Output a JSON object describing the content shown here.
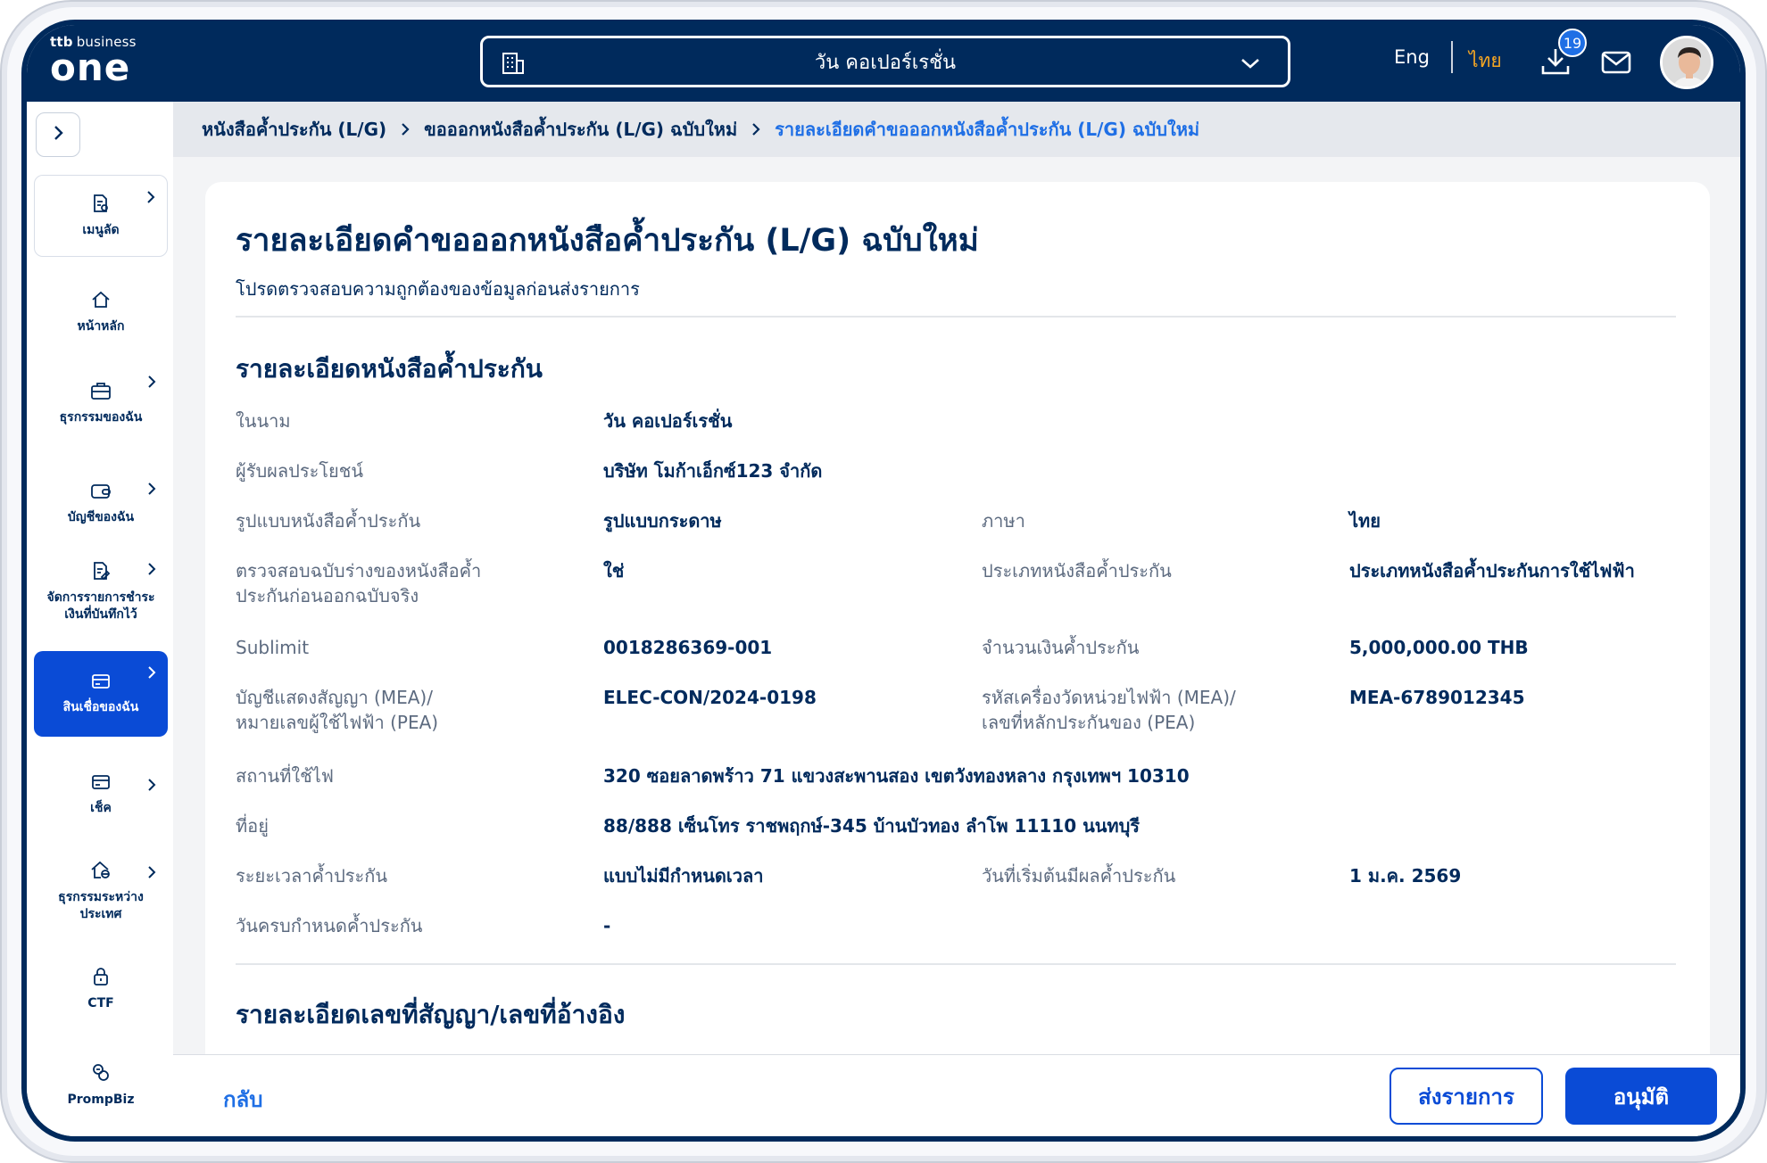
{
  "header": {
    "logo_brand": "ttb",
    "logo_small": "business",
    "logo_big": "one",
    "company": "วัน คอเปอร์เรชั่น",
    "lang_eng": "Eng",
    "lang_thai": "ไทย",
    "download_count": "19"
  },
  "sidebar": {
    "items": [
      {
        "label": "เมนูลัด"
      },
      {
        "label": "หน้าหลัก"
      },
      {
        "label": "ธุรกรรมของฉัน"
      },
      {
        "label": "บัญชีของฉัน"
      },
      {
        "label": "จัดการรายการชำระเงินที่บันทึกไว้"
      },
      {
        "label": "สินเชื่อของฉัน"
      },
      {
        "label": "เช็ค"
      },
      {
        "label": "ธุรกรรมระหว่างประเทศ"
      },
      {
        "label": "CTF"
      },
      {
        "label": "PrompBiz"
      }
    ]
  },
  "breadcrumb": {
    "items": [
      "หนังสือค้ำประกัน (L/G)",
      "ขอออกหนังสือค้ำประกัน (L/G) ฉบับใหม่",
      "รายละเอียดคำขอออกหนังสือค้ำประกัน (L/G) ฉบับใหม่"
    ]
  },
  "page": {
    "title": "รายละเอียดคำขอออกหนังสือค้ำประกัน (L/G) ฉบับใหม่",
    "subtitle": "โปรดตรวจสอบความถูกต้องของข้อมูลก่อนส่งรายการ",
    "section1_title": "รายละเอียดหนังสือค้ำประกัน",
    "section2_title": "รายละเอียดเลขที่สัญญา/เลขที่อ้างอิง"
  },
  "fields": {
    "name_label": "ในนาม",
    "name_value": "วัน คอเปอร์เรชั่น",
    "beneficiary_label": "ผู้รับผลประโยชน์",
    "beneficiary_value": "บริษัท โมก้าเอ็กซ์123 จำกัด",
    "format_label": "รูปแบบหนังสือค้ำประกัน",
    "format_value": "รูปแบบกระดาษ",
    "language_label": "ภาษา",
    "language_value": "ไทย",
    "draft_label_1": "ตรวจสอบฉบับร่างของหนังสือค้ำ",
    "draft_label_2": "ประกันก่อนออกฉบับจริง",
    "draft_value": "ใช่",
    "type_label": "ประเภทหนังสือค้ำประกัน",
    "type_value": "ประเภทหนังสือค้ำประกันการใช้ไฟฟ้า",
    "sublimit_label": "Sublimit",
    "sublimit_value": "0018286369-001",
    "amount_label": "จำนวนเงินค้ำประกัน",
    "amount_value": "5,000,000.00 THB",
    "contract_label_1": "บัญชีแสดงสัญญา (MEA)/",
    "contract_label_2": "หมายเลขผู้ใช้ไฟฟ้า (PEA)",
    "contract_value": "ELEC-CON/2024-0198",
    "meter_label_1": "รหัสเครื่องวัดหน่วยไฟฟ้า (MEA)/",
    "meter_label_2": "เลขที่หลักประกันของ (PEA)",
    "meter_value": "MEA-6789012345",
    "site_label": "สถานที่ใช้ไฟ",
    "site_value": "320 ซอยลาดพร้าว 71 แขวงสะพานสอง เขตวังทองหลาง กรุงเทพฯ 10310",
    "address_label": "ที่อยู่",
    "address_value": "88/888 เซ็นโทร ราชพฤกษ์-345 บ้านบัวทอง ลำโพ 11110 นนทบุรี",
    "period_label": "ระยะเวลาค้ำประกัน",
    "period_value": "แบบไม่มีกำหนดเวลา",
    "start_label": "วันที่เริ่มต้นมีผลค้ำประกัน",
    "start_value": "1 ม.ค. 2569",
    "end_label": "วันครบกำหนดค้ำประกัน",
    "end_value": "-"
  },
  "footer": {
    "back_label": "กลับ",
    "submit_label": "ส่งรายการ",
    "approve_label": "อนุมัติ"
  },
  "colors": {
    "navy": "#002a5c",
    "primary": "#0a4bd6",
    "link": "#1f6fe5",
    "accent_orange": "#f5a623"
  }
}
